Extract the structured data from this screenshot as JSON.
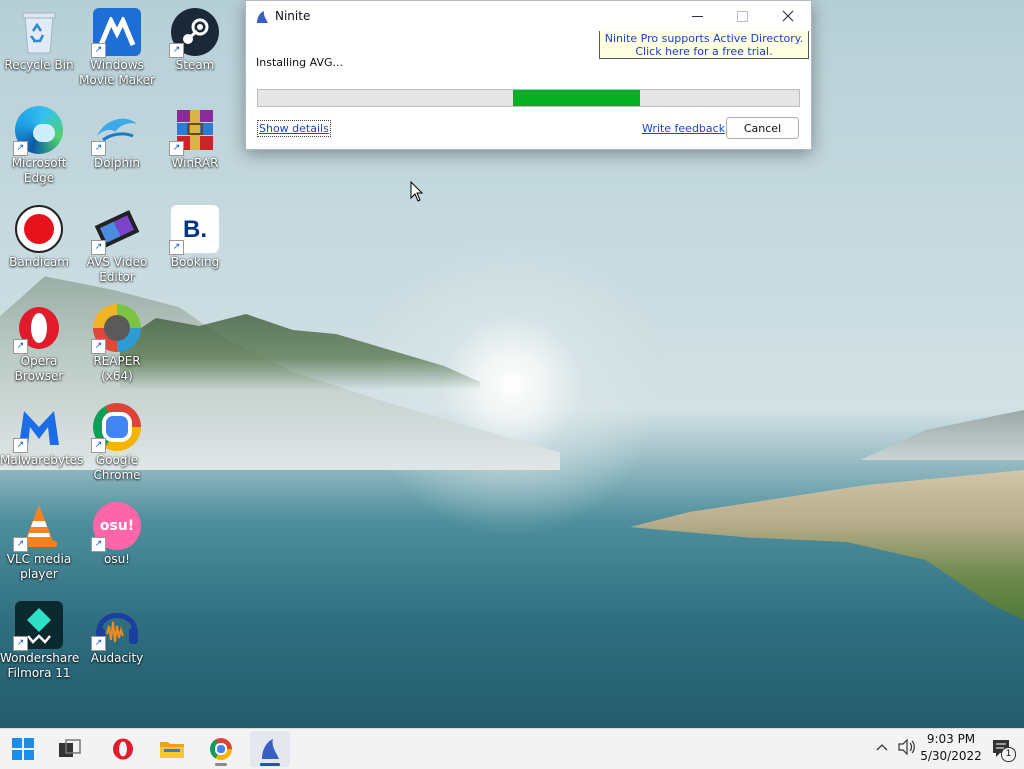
{
  "desktop": {
    "icons": [
      {
        "label": "Recycle Bin",
        "icon": "recycle-bin-icon"
      },
      {
        "label": "Windows Movie Maker",
        "icon": "movie-maker-icon"
      },
      {
        "label": "Steam",
        "icon": "steam-icon"
      },
      {
        "label": "Microsoft Edge",
        "icon": "edge-icon"
      },
      {
        "label": "Dolphin",
        "icon": "dolphin-icon"
      },
      {
        "label": "WinRAR",
        "icon": "winrar-icon"
      },
      {
        "label": "Bandicam",
        "icon": "bandicam-icon"
      },
      {
        "label": "AVS Video Editor",
        "icon": "avs-video-editor-icon"
      },
      {
        "label": "Booking",
        "icon": "booking-icon",
        "glyph": "B."
      },
      {
        "label": "Opera Browser",
        "icon": "opera-icon"
      },
      {
        "label": "REAPER (x64)",
        "icon": "reaper-icon"
      },
      {
        "label": "Malwarebytes",
        "icon": "malwarebytes-icon"
      },
      {
        "label": "Google Chrome",
        "icon": "chrome-icon"
      },
      {
        "label": "VLC media player",
        "icon": "vlc-icon"
      },
      {
        "label": "osu!",
        "icon": "osu-icon",
        "glyph": "osu!"
      },
      {
        "label": "Wondershare Filmora 11",
        "icon": "filmora-icon"
      },
      {
        "label": "Audacity",
        "icon": "audacity-icon"
      }
    ]
  },
  "ninite": {
    "title": "Ninite",
    "promo_line1": "Ninite Pro supports Active Directory.",
    "promo_line2": "Click here for a free trial.",
    "status": "Installing AVG...",
    "progress_start": 0.472,
    "progress_end": 0.707,
    "progress_color": "#06b025",
    "show_details": "Show details",
    "write_feedback": "Write feedback",
    "cancel": "Cancel"
  },
  "taskbar": {
    "apps": [
      "start-icon",
      "task-view-icon",
      "opera-icon",
      "file-explorer-icon",
      "chrome-icon",
      "ninite-icon"
    ],
    "time": "9:03 PM",
    "date": "5/30/2022",
    "notification_count": "1"
  },
  "colors": {
    "link": "#1848c8",
    "accent": "#005fb8"
  }
}
